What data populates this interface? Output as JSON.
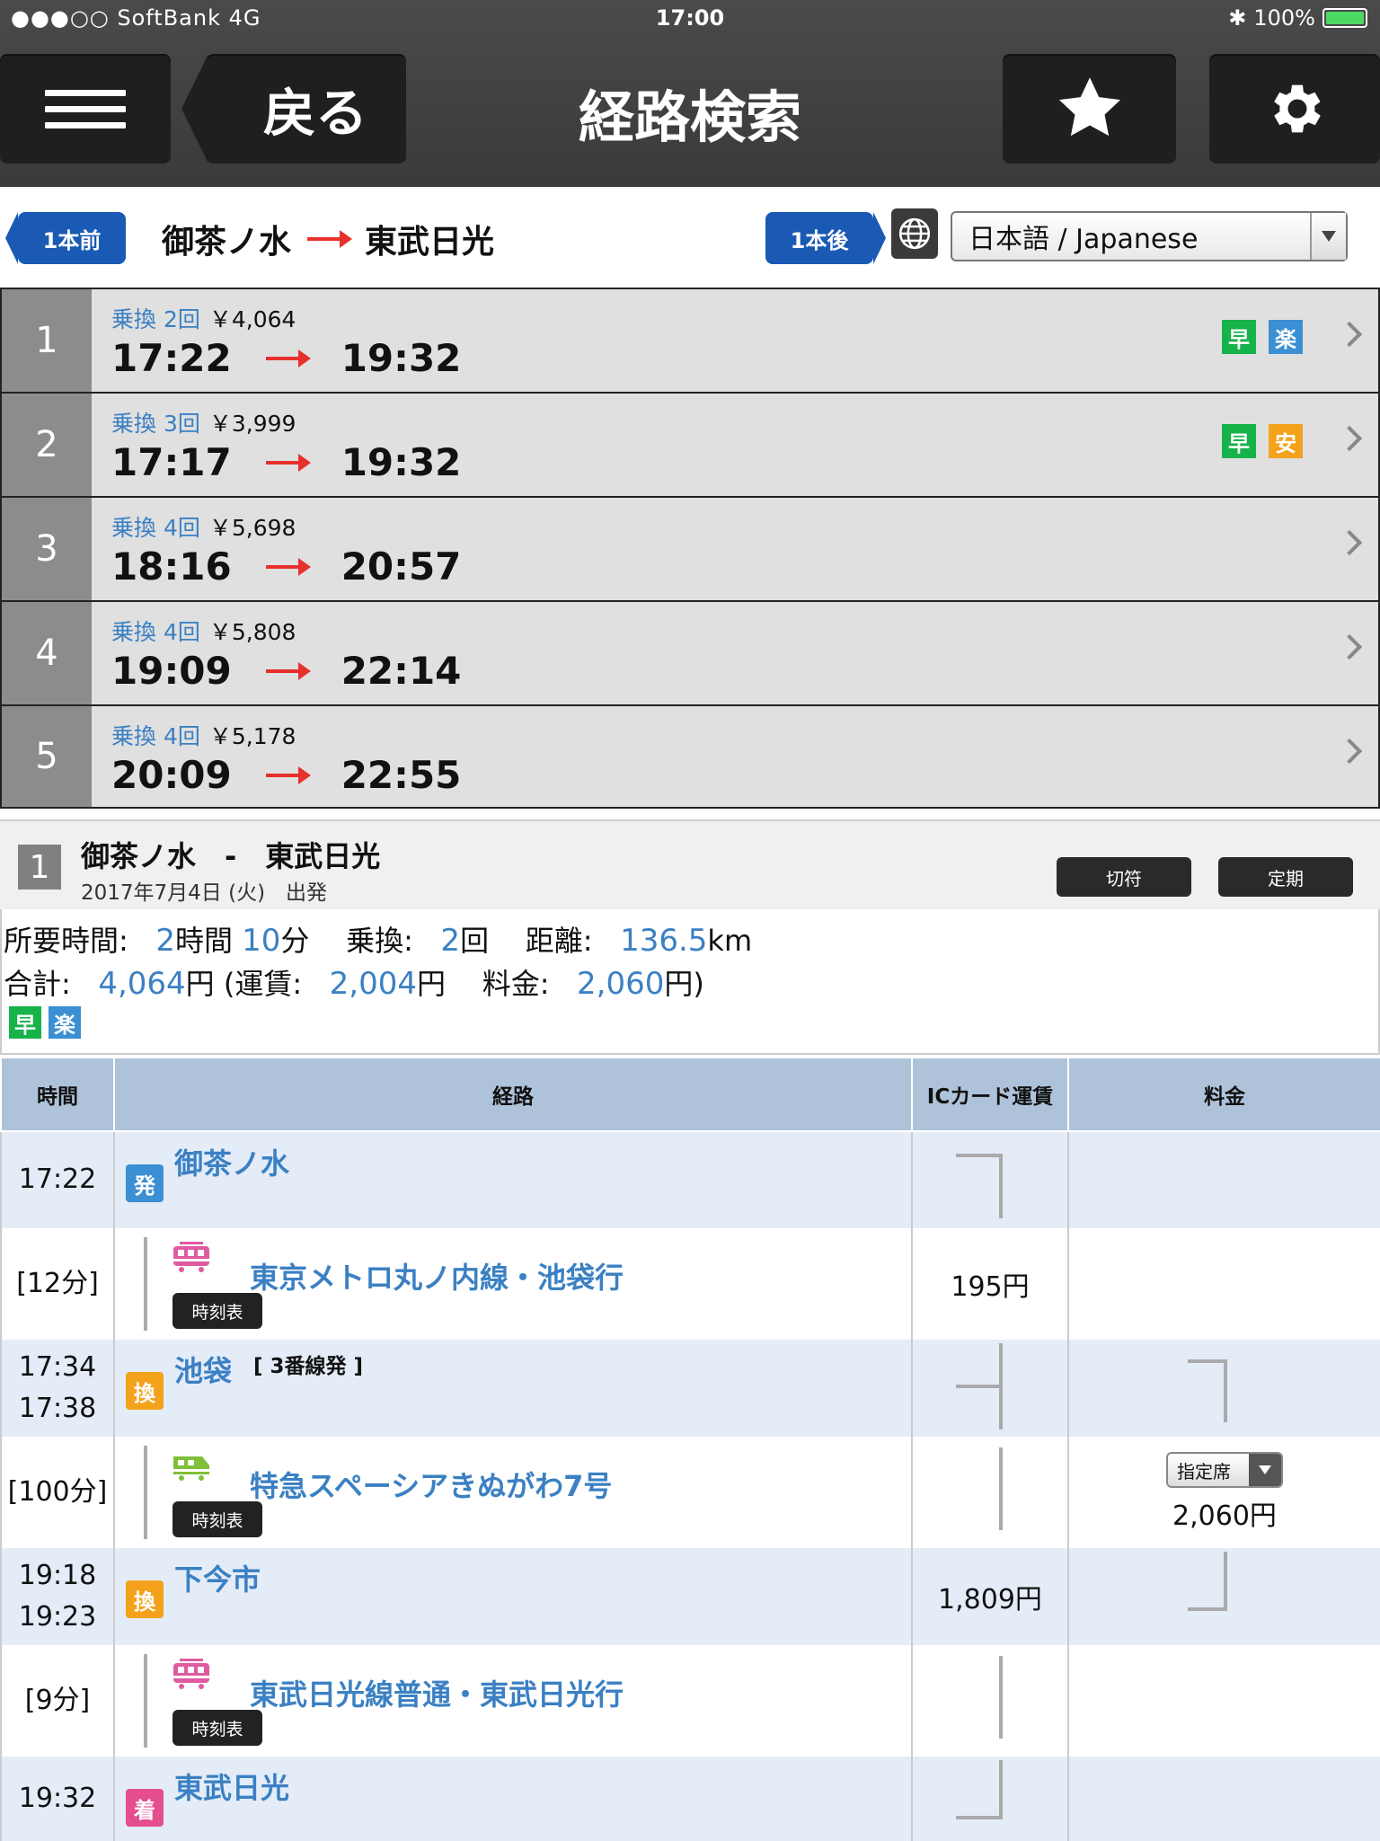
{
  "status": {
    "carrier": "●●●○○ SoftBank   4G",
    "time": "17:00",
    "battery": "100%"
  },
  "header": {
    "title": "経路検索",
    "back_label": "戻る"
  },
  "nav": {
    "prev_label": "1本前",
    "next_label": "1本後",
    "from": "御茶ノ水",
    "to": "東武日光",
    "language": "日本語 / Japanese"
  },
  "results": [
    {
      "num": "1",
      "xfer": "乗換 2回",
      "price": "￥4,064",
      "dep": "17:22",
      "arr": "19:32",
      "badges": [
        "早",
        "楽"
      ]
    },
    {
      "num": "2",
      "xfer": "乗換 3回",
      "price": "￥3,999",
      "dep": "17:17",
      "arr": "19:32",
      "badges": [
        "早",
        "安"
      ]
    },
    {
      "num": "3",
      "xfer": "乗換 4回",
      "price": "￥5,698",
      "dep": "18:16",
      "arr": "20:57",
      "badges": []
    },
    {
      "num": "4",
      "xfer": "乗換 4回",
      "price": "￥5,808",
      "dep": "19:09",
      "arr": "22:14",
      "badges": []
    },
    {
      "num": "5",
      "xfer": "乗換 4回",
      "price": "￥5,178",
      "dep": "20:09",
      "arr": "22:55",
      "badges": []
    }
  ],
  "detail": {
    "num": "1",
    "route": "御茶ノ水　-　東武日光",
    "date": "2017年7月4日 (火)　出発",
    "ticket_btn": "切符",
    "pass_btn": "定期",
    "summary": {
      "time_label": "所要時間:",
      "hours": "2",
      "hours_unit": "時間",
      "mins": "10",
      "mins_unit": "分",
      "xfer_label": "乗換:",
      "xfer": "2",
      "xfer_unit": "回",
      "dist_label": "距離:",
      "dist": "136.5",
      "dist_unit": "km",
      "total_label": "合計:",
      "total": "4,064",
      "yen": "円",
      "fare_label": "(運賃:",
      "fare": "2,004",
      "fee_label": "料金:",
      "fee": "2,060",
      "close": "円)",
      "badges": [
        "早",
        "楽"
      ]
    },
    "columns": [
      "時間",
      "経路",
      "ICカード運賃",
      "料金"
    ],
    "rows": [
      {
        "type": "station",
        "time": "17:22",
        "badge": "発",
        "name": "御茶ノ水",
        "platform": ""
      },
      {
        "type": "segment",
        "time": "[12分]",
        "line": "東京メトロ丸ノ内線・池袋行",
        "fare": "195円",
        "tt": "時刻表"
      },
      {
        "type": "station",
        "time": "17:34\n17:38",
        "badge": "換",
        "name": "池袋",
        "platform": "[ 3番線発 ]"
      },
      {
        "type": "segment",
        "time": "[100分]",
        "line": "特急スペーシアきぬがわ7号",
        "seat": "指定席",
        "fee": "2,060円",
        "tt": "時刻表"
      },
      {
        "type": "station",
        "time": "19:18\n19:23",
        "badge": "換",
        "name": "下今市",
        "fare": "1,809円"
      },
      {
        "type": "segment",
        "time": "[9分]",
        "line": "東武日光線普通・東武日光行",
        "tt": "時刻表"
      },
      {
        "type": "station",
        "time": "19:32",
        "badge": "着",
        "name": "東武日光"
      }
    ]
  }
}
